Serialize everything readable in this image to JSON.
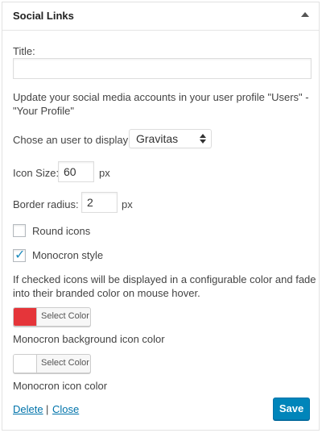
{
  "widget": {
    "title": "Social Links"
  },
  "fields": {
    "title_label": "Title:",
    "title_value": "",
    "help_text_line1": "Update your social media accounts in your user profile \"Users\" -",
    "help_text_line2": "\"Your Profile\"",
    "user_label": "Chose an user to display:",
    "user_selected": "Gravitas",
    "icon_size_label": "Icon Size:",
    "icon_size_value": "60",
    "icon_size_unit": "px",
    "border_radius_label": "Border radius:",
    "border_radius_value": "2",
    "border_radius_unit": "px",
    "round_icons_label": "Round icons",
    "round_icons_checked": false,
    "monocron_label": "Monocron style",
    "monocron_checked": true,
    "monocron_help_line1": "If checked icons will be displayed in a configurable color and fade",
    "monocron_help_line2": "into their branded color on mouse hover."
  },
  "colors": {
    "background_button_label": "Select Color",
    "background_color": "#e5353a",
    "background_caption": "Monocron background icon color",
    "icon_button_label": "Select Color",
    "icon_color": "#ffffff",
    "icon_caption": "Monocron icon color"
  },
  "actions": {
    "delete_label": "Delete",
    "separator": "|",
    "close_label": "Close",
    "save_label": "Save"
  },
  "theme": {
    "link_color": "#0073aa",
    "primary_button_color": "#0085ba",
    "checkmark_color": "#1e8cbe"
  }
}
